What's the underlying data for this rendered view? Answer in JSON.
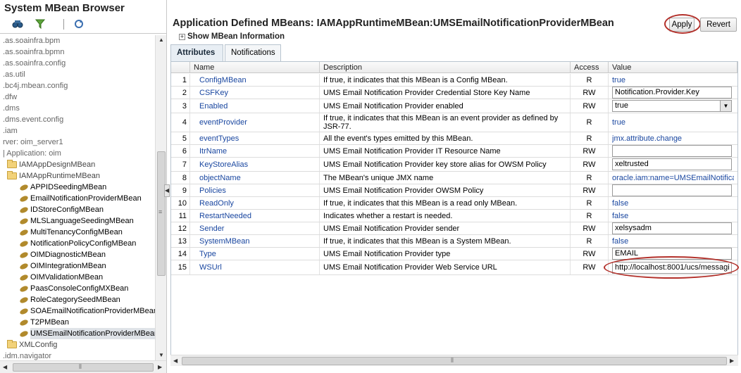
{
  "left_panel": {
    "title": "System MBean Browser",
    "tree": [
      {
        "label": ".as.soainfra.bpm",
        "kind": "text"
      },
      {
        "label": ".as.soainfra.bpmn",
        "kind": "text"
      },
      {
        "label": ".as.soainfra.config",
        "kind": "text"
      },
      {
        "label": ".as.util",
        "kind": "text"
      },
      {
        "label": ".bc4j.mbean.config",
        "kind": "text"
      },
      {
        "label": ".dfw",
        "kind": "text"
      },
      {
        "label": ".dms",
        "kind": "text"
      },
      {
        "label": ".dms.event.config",
        "kind": "text"
      },
      {
        "label": ".iam",
        "kind": "text"
      },
      {
        "label": "rver: oim_server1",
        "kind": "text"
      },
      {
        "label": "| Application: oim",
        "kind": "text"
      },
      {
        "label": "IAMAppDesignMBean",
        "kind": "folder"
      },
      {
        "label": "IAMAppRuntimeMBean",
        "kind": "folder"
      },
      {
        "label": "APPIDSeedingMBean",
        "kind": "mbean"
      },
      {
        "label": "EmailNotificationProviderMBean",
        "kind": "mbean"
      },
      {
        "label": "IDStoreConfigMBean",
        "kind": "mbean"
      },
      {
        "label": "MLSLanguageSeedingMBean",
        "kind": "mbean"
      },
      {
        "label": "MultiTenancyConfigMBean",
        "kind": "mbean"
      },
      {
        "label": "NotificationPolicyConfigMBean",
        "kind": "mbean"
      },
      {
        "label": "OIMDiagnosticMBean",
        "kind": "mbean"
      },
      {
        "label": "OIMIntegrationMBean",
        "kind": "mbean"
      },
      {
        "label": "OIMValidationMBean",
        "kind": "mbean"
      },
      {
        "label": "PaasConsoleConfigMXBean",
        "kind": "mbean"
      },
      {
        "label": "RoleCategorySeedMBean",
        "kind": "mbean"
      },
      {
        "label": "SOAEmailNotificationProviderMBean",
        "kind": "mbean"
      },
      {
        "label": "T2PMBean",
        "kind": "mbean"
      },
      {
        "label": "UMSEmailNotificationProviderMBean",
        "kind": "mbean",
        "selected": true
      },
      {
        "label": "XMLConfig",
        "kind": "folder"
      },
      {
        "label": ".idm.navigator",
        "kind": "text"
      }
    ]
  },
  "header": {
    "title": "Application Defined MBeans: IAMAppRuntimeMBean:UMSEmailNotificationProviderMBean",
    "show_info": "Show MBean Information",
    "apply_label": "Apply",
    "revert_label": "Revert"
  },
  "tabs": [
    {
      "label": "Attributes",
      "active": true
    },
    {
      "label": "Notifications",
      "active": false
    }
  ],
  "table": {
    "columns": [
      "Name",
      "Description",
      "Access",
      "Value"
    ],
    "rows": [
      {
        "num": "1",
        "name": "ConfigMBean",
        "desc": "If true, it indicates that this MBean is a Config MBean.",
        "access": "R",
        "value": "true",
        "vtype": "link"
      },
      {
        "num": "2",
        "name": "CSFKey",
        "desc": "UMS Email Notification Provider Credential Store Key Name",
        "access": "RW",
        "value": "Notification.Provider.Key",
        "vtype": "input"
      },
      {
        "num": "3",
        "name": "Enabled",
        "desc": "UMS Email Notification Provider enabled",
        "access": "RW",
        "value": "true",
        "vtype": "select"
      },
      {
        "num": "4",
        "name": "eventProvider",
        "desc": "If true, it indicates that this MBean is an event provider as defined by JSR-77.",
        "access": "R",
        "value": "true",
        "vtype": "link"
      },
      {
        "num": "5",
        "name": "eventTypes",
        "desc": "All the event's types emitted by this MBean.",
        "access": "R",
        "value": "jmx.attribute.change",
        "vtype": "link"
      },
      {
        "num": "6",
        "name": "ItrName",
        "desc": "UMS Email Notification Provider IT Resource Name",
        "access": "RW",
        "value": "",
        "vtype": "input"
      },
      {
        "num": "7",
        "name": "KeyStoreAlias",
        "desc": "UMS Email Notification Provider key store alias for OWSM Policy",
        "access": "RW",
        "value": "xeltrusted",
        "vtype": "input"
      },
      {
        "num": "8",
        "name": "objectName",
        "desc": "The MBean's unique JMX name",
        "access": "R",
        "value": "oracle.iam:name=UMSEmailNotifica...",
        "vtype": "link"
      },
      {
        "num": "9",
        "name": "Policies",
        "desc": "UMS Email Notification Provider OWSM Policy",
        "access": "RW",
        "value": "",
        "vtype": "input"
      },
      {
        "num": "10",
        "name": "ReadOnly",
        "desc": "If true, it indicates that this MBean is a read only MBean.",
        "access": "R",
        "value": "false",
        "vtype": "link"
      },
      {
        "num": "11",
        "name": "RestartNeeded",
        "desc": "Indicates whether a restart is needed.",
        "access": "R",
        "value": "false",
        "vtype": "link"
      },
      {
        "num": "12",
        "name": "Sender",
        "desc": "UMS Email Notification Provider sender",
        "access": "RW",
        "value": "xelsysadm",
        "vtype": "input"
      },
      {
        "num": "13",
        "name": "SystemMBean",
        "desc": "If true, it indicates that this MBean is a System MBean.",
        "access": "R",
        "value": "false",
        "vtype": "link"
      },
      {
        "num": "14",
        "name": "Type",
        "desc": "UMS Email Notification Provider type",
        "access": "RW",
        "value": "EMAIL",
        "vtype": "input"
      },
      {
        "num": "15",
        "name": "WSUrl",
        "desc": "UMS Email Notification Provider Web Service URL",
        "access": "RW",
        "value": "http://localhost:8001/ucs/messagi",
        "vtype": "input"
      }
    ]
  },
  "colors": {
    "link": "#1a47a0",
    "highlight_oval": "#b3302a",
    "folder": "#f2d27a"
  }
}
